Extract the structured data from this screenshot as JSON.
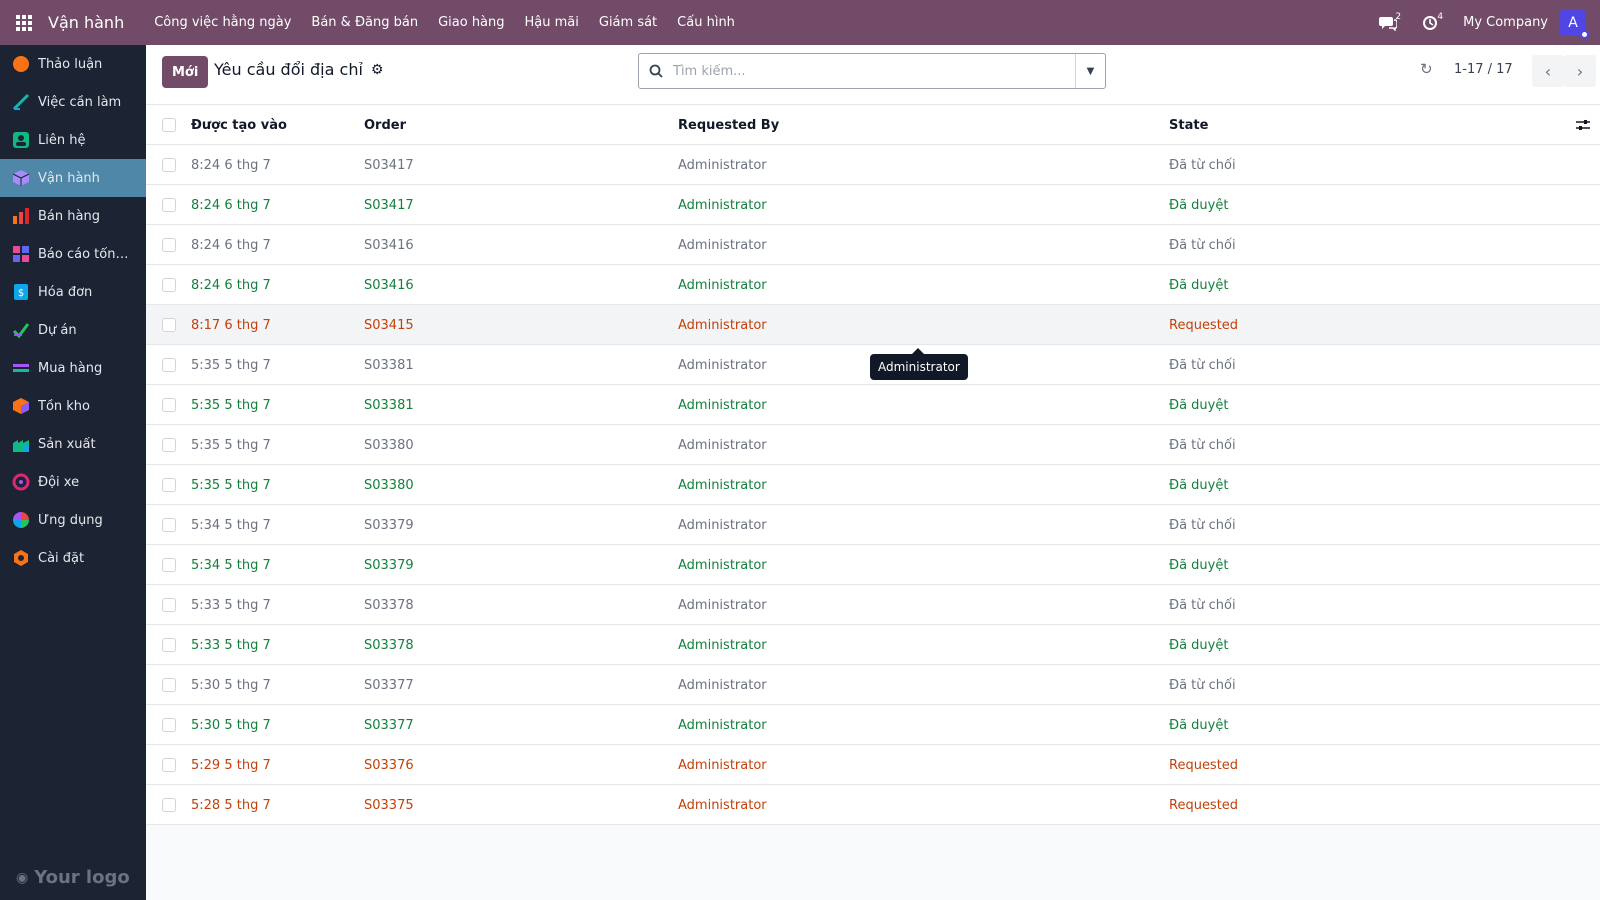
{
  "navbar": {
    "app_title": "Vận hành",
    "menu": [
      "Công việc hằng ngày",
      "Bán & Đăng bán",
      "Giao hàng",
      "Hậu mãi",
      "Giám sát",
      "Cấu hình"
    ],
    "messages_count": "2",
    "activities_count": "4",
    "company": "My Company",
    "avatar_letter": "A",
    "colors": {
      "bar": "#714b67"
    }
  },
  "sidebar": {
    "items": [
      {
        "label": "Thảo luận",
        "icon": "discuss-icon"
      },
      {
        "label": "Việc cần làm",
        "icon": "todo-icon"
      },
      {
        "label": "Liên hệ",
        "icon": "contacts-icon"
      },
      {
        "label": "Vận hành",
        "icon": "operations-icon",
        "active": true
      },
      {
        "label": "Bán hàng",
        "icon": "sales-icon"
      },
      {
        "label": "Báo cáo tổng ...",
        "icon": "reporting-icon"
      },
      {
        "label": "Hóa đơn",
        "icon": "invoice-icon"
      },
      {
        "label": "Dự án",
        "icon": "project-icon"
      },
      {
        "label": "Mua hàng",
        "icon": "purchase-icon"
      },
      {
        "label": "Tồn kho",
        "icon": "inventory-icon"
      },
      {
        "label": "Sản xuất",
        "icon": "manufacturing-icon"
      },
      {
        "label": "Đội xe",
        "icon": "fleet-icon"
      },
      {
        "label": "Ứng dụng",
        "icon": "apps-icon"
      },
      {
        "label": "Cài đặt",
        "icon": "settings-icon"
      }
    ],
    "logo_text": "Your logo"
  },
  "control": {
    "new_label": "Mới",
    "title": "Yêu cầu đổi địa chỉ",
    "search_placeholder": "Tìm kiếm...",
    "pager": "1-17 / 17"
  },
  "table": {
    "columns": [
      "Được tạo vào",
      "Order",
      "Requested By",
      "State"
    ],
    "rows": [
      {
        "date": "8:24 6 thg 7",
        "order": "S03417",
        "by": "Administrator",
        "state": "Đã từ chối",
        "tone": "muted"
      },
      {
        "date": "8:24 6 thg 7",
        "order": "S03417",
        "by": "Administrator",
        "state": "Đã duyệt",
        "tone": "green"
      },
      {
        "date": "8:24 6 thg 7",
        "order": "S03416",
        "by": "Administrator",
        "state": "Đã từ chối",
        "tone": "muted"
      },
      {
        "date": "8:24 6 thg 7",
        "order": "S03416",
        "by": "Administrator",
        "state": "Đã duyệt",
        "tone": "green"
      },
      {
        "date": "8:17 6 thg 7",
        "order": "S03415",
        "by": "Administrator",
        "state": "Requested",
        "tone": "orange",
        "hover": true
      },
      {
        "date": "5:35 5 thg 7",
        "order": "S03381",
        "by": "Administrator",
        "state": "Đã từ chối",
        "tone": "muted"
      },
      {
        "date": "5:35 5 thg 7",
        "order": "S03381",
        "by": "Administrator",
        "state": "Đã duyệt",
        "tone": "green"
      },
      {
        "date": "5:35 5 thg 7",
        "order": "S03380",
        "by": "Administrator",
        "state": "Đã từ chối",
        "tone": "muted"
      },
      {
        "date": "5:35 5 thg 7",
        "order": "S03380",
        "by": "Administrator",
        "state": "Đã duyệt",
        "tone": "green"
      },
      {
        "date": "5:34 5 thg 7",
        "order": "S03379",
        "by": "Administrator",
        "state": "Đã từ chối",
        "tone": "muted"
      },
      {
        "date": "5:34 5 thg 7",
        "order": "S03379",
        "by": "Administrator",
        "state": "Đã duyệt",
        "tone": "green"
      },
      {
        "date": "5:33 5 thg 7",
        "order": "S03378",
        "by": "Administrator",
        "state": "Đã từ chối",
        "tone": "muted"
      },
      {
        "date": "5:33 5 thg 7",
        "order": "S03378",
        "by": "Administrator",
        "state": "Đã duyệt",
        "tone": "green"
      },
      {
        "date": "5:30 5 thg 7",
        "order": "S03377",
        "by": "Administrator",
        "state": "Đã từ chối",
        "tone": "muted"
      },
      {
        "date": "5:30 5 thg 7",
        "order": "S03377",
        "by": "Administrator",
        "state": "Đã duyệt",
        "tone": "green"
      },
      {
        "date": "5:29 5 thg 7",
        "order": "S03376",
        "by": "Administrator",
        "state": "Requested",
        "tone": "orange"
      },
      {
        "date": "5:28 5 thg 7",
        "order": "S03375",
        "by": "Administrator",
        "state": "Requested",
        "tone": "orange"
      }
    ]
  },
  "tooltip": {
    "text": "Administrator"
  }
}
